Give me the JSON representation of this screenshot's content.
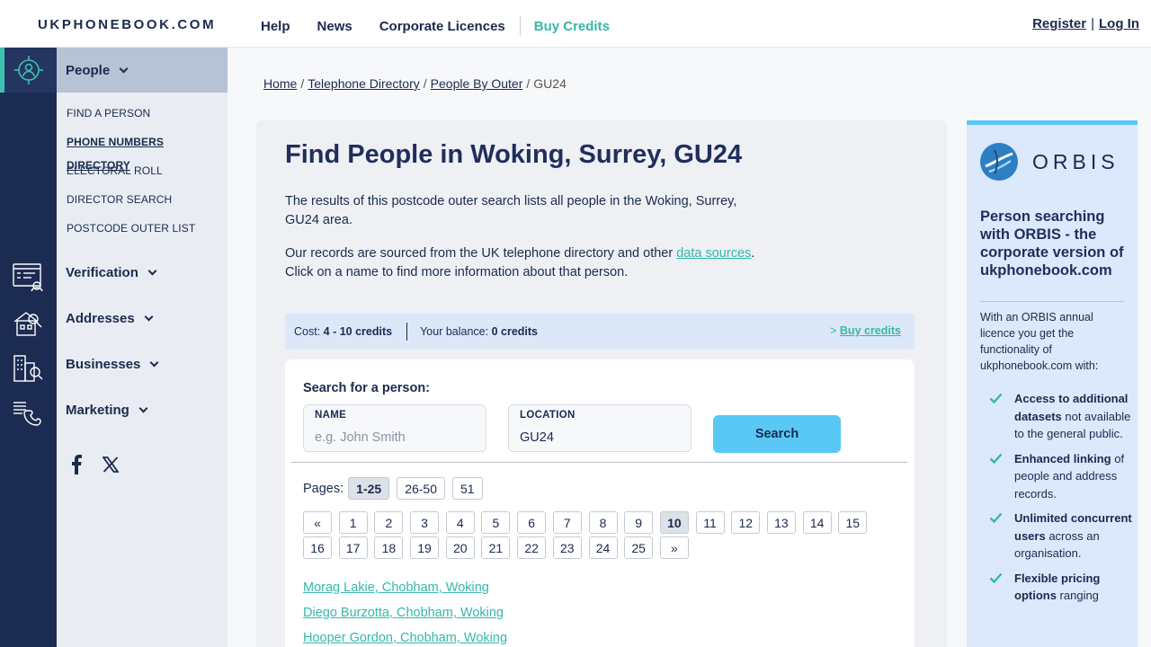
{
  "header": {
    "logo": "UKPHONEBOOK.COM",
    "nav": [
      "Help",
      "News",
      "Corporate Licences"
    ],
    "buy_credits": "Buy Credits",
    "register": "Register",
    "separator": "|",
    "login": "Log In"
  },
  "sidebar": {
    "section": "People",
    "sub_items": [
      "FIND A PERSON",
      "PHONE NUMBERS DIRECTORY",
      "ELECTORAL ROLL",
      "DIRECTOR SEARCH",
      "POSTCODE OUTER LIST"
    ],
    "categories": [
      "Verification",
      "Addresses",
      "Businesses",
      "Marketing"
    ]
  },
  "breadcrumb": {
    "home": "Home",
    "directory": "Telephone Directory",
    "outer": "People By Outer",
    "current": "GU24",
    "sep": "/"
  },
  "main": {
    "title": "Find People in Woking, Surrey, GU24",
    "intro": "The results of this postcode outer search lists all people in the Woking, Surrey, GU24 area.",
    "records_prefix": "Our records are sourced from the UK telephone directory and other ",
    "records_link": "data sources",
    "records_suffix": ".",
    "click_text": "Click on a name to find more information about that person.",
    "cost_label": "Cost: ",
    "cost_value": "4 - 10 credits",
    "balance_label": "Your balance: ",
    "balance_value": "0 credits",
    "buy_prefix": "> ",
    "buy_link": "Buy credits"
  },
  "search": {
    "heading": "Search for a person:",
    "name_label": "NAME",
    "name_placeholder": "e.g. John Smith",
    "location_label": "LOCATION",
    "location_value": "GU24",
    "button": "Search"
  },
  "pagination": {
    "label": "Pages:",
    "ranges": [
      "1-25",
      "26-50",
      "51"
    ],
    "active_range": "1-25",
    "first": "«",
    "last": "»",
    "pages": [
      "1",
      "2",
      "3",
      "4",
      "5",
      "6",
      "7",
      "8",
      "9",
      "10",
      "11",
      "12",
      "13",
      "14",
      "15",
      "16",
      "17",
      "18",
      "19",
      "20",
      "21",
      "22",
      "23",
      "24",
      "25"
    ],
    "current": "10"
  },
  "people": [
    "Morag Lakie, Chobham, Woking",
    "Diego Burzotta, Chobham, Woking",
    "Hooper Gordon, Chobham, Woking"
  ],
  "ad": {
    "brand": "ORBIS",
    "heading": "Person searching with ORBIS - the corporate version of ukphonebook.com",
    "intro": "With an ORBIS annual licence you get the functionality of ukphonebook.com with:",
    "features": [
      {
        "bold": "Access to additional datasets",
        "rest": " not available to the general public."
      },
      {
        "bold": "Enhanced linking",
        "rest": " of people and address records."
      },
      {
        "bold": "Unlimited concurrent users",
        "rest": " across an organisation."
      },
      {
        "bold": "Flexible pricing options",
        "rest": " ranging"
      }
    ]
  },
  "colors": {
    "navy": "#1c2b52",
    "teal": "#35b8a8",
    "button": "#5ac8f5"
  }
}
